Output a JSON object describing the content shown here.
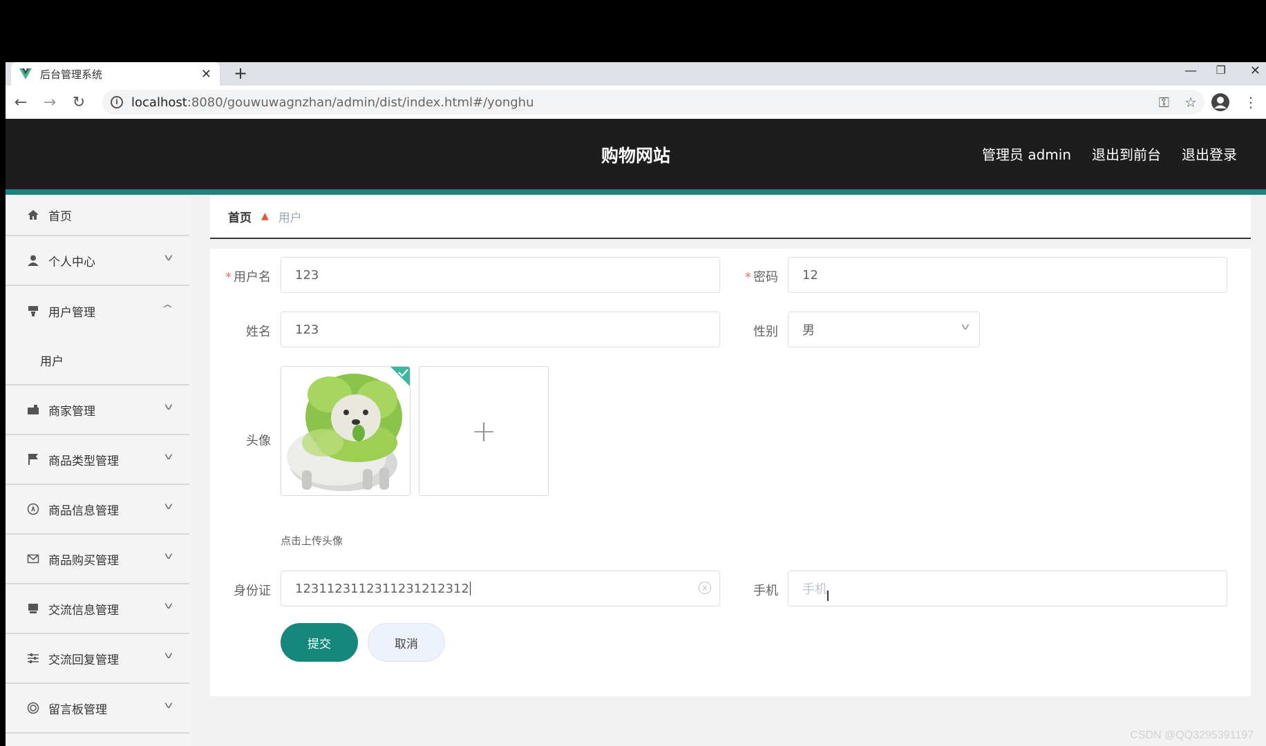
{
  "browser": {
    "tab_title": "后台管理系统",
    "url_host": "localhost",
    "url_rest": ":8080/gouwuwagnzhan/admin/dist/index.html#/yonghu"
  },
  "header": {
    "site_title": "购物网站",
    "admin_label": "管理员 admin",
    "to_front_label": "退出到前台",
    "logout_label": "退出登录"
  },
  "sidebar": {
    "items": [
      {
        "label": "首页",
        "icon": "home-icon"
      },
      {
        "label": "个人中心",
        "icon": "user-icon"
      },
      {
        "label": "用户管理",
        "icon": "users-icon",
        "expanded": true
      },
      {
        "label": "商家管理",
        "icon": "store-icon"
      },
      {
        "label": "商品类型管理",
        "icon": "flag-icon"
      },
      {
        "label": "商品信息管理",
        "icon": "info-icon"
      },
      {
        "label": "商品购买管理",
        "icon": "mail-icon"
      },
      {
        "label": "交流信息管理",
        "icon": "chat-icon"
      },
      {
        "label": "交流回复管理",
        "icon": "sliders-icon"
      },
      {
        "label": "留言板管理",
        "icon": "ring-icon"
      }
    ],
    "submenu_label": "用户"
  },
  "breadcrumb": {
    "home": "首页",
    "current": "用户"
  },
  "form": {
    "username_label": "用户名",
    "username_value": "123",
    "password_label": "密码",
    "password_value": "12",
    "name_label": "姓名",
    "name_value": "123",
    "gender_label": "性别",
    "gender_value": "男",
    "avatar_label": "头像",
    "avatar_hint": "点击上传头像",
    "idcard_label": "身份证",
    "idcard_value": "123112311231123121231​2",
    "phone_label": "手机",
    "phone_placeholder": "手机",
    "submit_label": "提交",
    "cancel_label": "取消"
  },
  "watermark": "CSDN @QQ3295391197",
  "colors": {
    "topbar": "#1d1d1d",
    "accent": "#15877c",
    "required": "#f56c6c"
  }
}
